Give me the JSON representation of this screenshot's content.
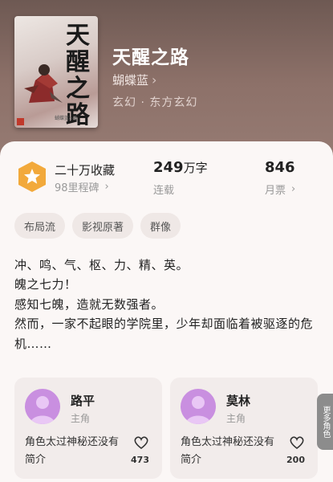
{
  "book": {
    "title": "天醒之路",
    "author": "蝴蝶蓝",
    "genre": "玄幻 · 东方玄幻",
    "cover": {
      "title_chars": [
        "天",
        "醒",
        "之",
        "路"
      ],
      "author_mark": "蝴蝶蓝◇著"
    }
  },
  "stats": {
    "collection": {
      "label": "二十万收藏",
      "sub": "98里程碑"
    },
    "words": {
      "value": "249",
      "unit": "万字",
      "sub": "连载"
    },
    "tickets": {
      "value": "846",
      "sub": "月票"
    }
  },
  "tags": [
    "布局流",
    "影视原著",
    "群像"
  ],
  "synopsis": [
    "冲、鸣、气、枢、力、精、英。",
    "魄之七力！",
    "感知七魄，造就无数强者。",
    "然而，一家不起眼的学院里，少年却面临着被驱逐的危机……"
  ],
  "characters": [
    {
      "name": "路平",
      "role": "主角",
      "desc": "角色太过神秘还没有简介",
      "likes": "473"
    },
    {
      "name": "莫林",
      "role": "主角",
      "desc": "角色太过神秘还没有简介",
      "likes": "200"
    }
  ],
  "more_roles_label": "更多角色",
  "colors": {
    "badge": "#f2a93b",
    "avatar": "#c98fe0",
    "sheet": "#fbf7f6"
  }
}
